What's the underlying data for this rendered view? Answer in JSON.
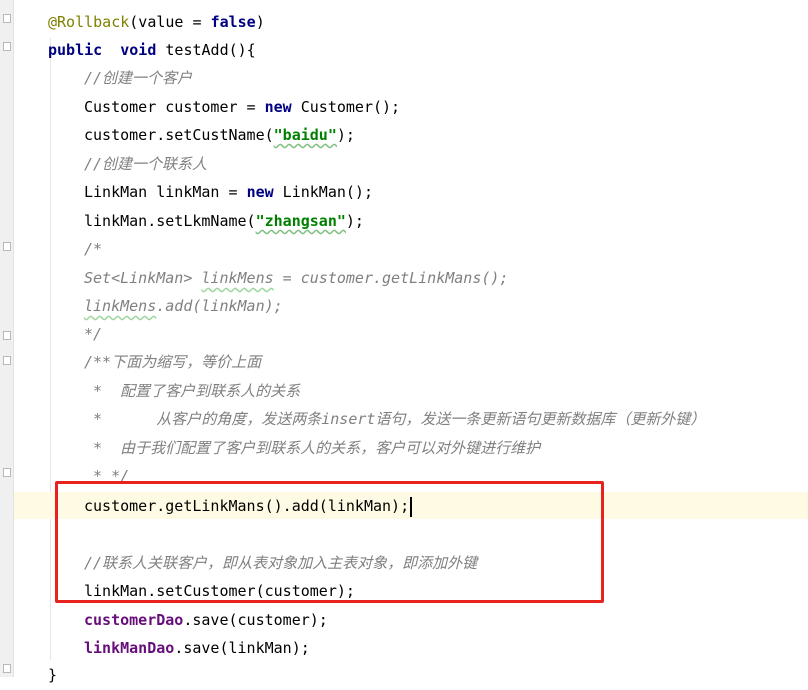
{
  "code": {
    "annotation": "@Rollback",
    "annotation_args": "(value = ",
    "false_kw": "false",
    "annotation_close": ")",
    "public_kw": "public",
    "void_kw": "void",
    "method_sig": "testAdd(){",
    "cm_create_customer": "//创建一个客户",
    "customer_decl": "Customer customer = ",
    "new_kw": "new",
    "customer_ctor": " Customer();",
    "setcustname_pre": "customer.setCustName(",
    "str_baidu": "\"baidu\"",
    "close_paren_semi": ");",
    "cm_create_linkman": "//创建一个联系人",
    "linkman_decl": "LinkMan linkMan = ",
    "linkman_ctor": " LinkMan();",
    "setlkmname_pre": "linkMan.setLkmName(",
    "str_zhangsan": "\"zhangsan\"",
    "cm_block_open": "/*",
    "cm_set_line_a": "Set<LinkMan> ",
    "cm_set_line_b": "linkMens",
    "cm_set_line_c": " = customer.getLinkMans();",
    "cm_add_line_a": "linkMens",
    "cm_add_line_b": ".add(linkMan);",
    "cm_block_close": "*/",
    "doc_open": "/**",
    "doc_line1": "下面为缩写，等价上面",
    "doc_line2": " *  配置了客户到联系人的关系",
    "doc_line3": " *      从客户的角度，发送两条insert语句，发送一条更新语句更新数据库（更新外键）",
    "doc_line4": " *  由于我们配置了客户到联系人的关系，客户可以对外键进行维护",
    "doc_close": " * */",
    "add_linkman_line": "customer.getLinkMans().add(linkMan);",
    "cm_linkman_assoc": "//联系人关联客户，即从表对象加入主表对象，即添加外键",
    "setcustomer_line": "linkMan.setCustomer(customer);",
    "customer_dao": "customerDao",
    "customer_dao_save": ".save(customer);",
    "linkman_dao": "linkManDao",
    "linkman_dao_save": ".save(linkMan);",
    "closing_brace": "}"
  },
  "colors": {
    "keyword": "#000080",
    "annotation": "#808000",
    "comment": "#808080",
    "string": "#008000",
    "field": "#660e7a",
    "current_line": "#fffae3",
    "highlight_box": "#e8231f"
  }
}
